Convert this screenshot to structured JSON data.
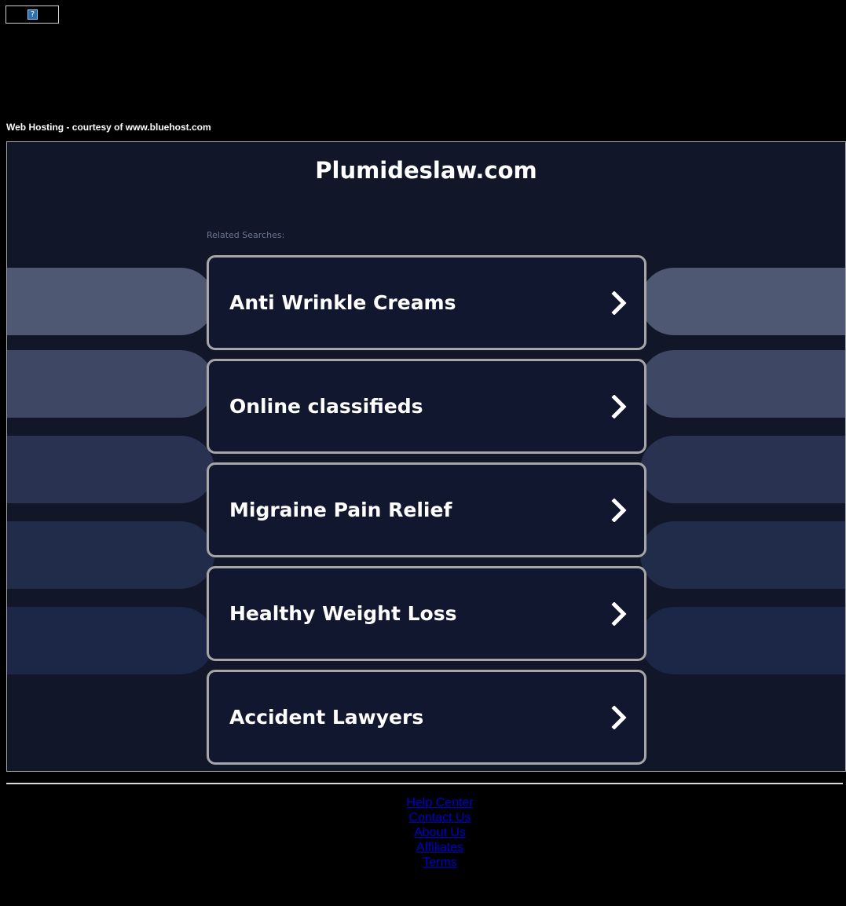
{
  "banner": {
    "icon": "broken-image-icon",
    "icon_glyph": "?"
  },
  "hosting_note": "Web Hosting - courtesy of www.bluehost.com",
  "site_title": "Plumideslaw.com",
  "related_label": "Related Searches:",
  "searches": [
    {
      "label": "Anti Wrinkle Creams"
    },
    {
      "label": "Online classifieds"
    },
    {
      "label": "Migraine Pain Relief"
    },
    {
      "label": "Healthy Weight Loss"
    },
    {
      "label": "Accident Lawyers"
    }
  ],
  "footer_links": [
    {
      "label": "Help Center"
    },
    {
      "label": "Contact Us"
    },
    {
      "label": "About Us"
    },
    {
      "label": "Affiliates"
    },
    {
      "label": "Terms"
    }
  ],
  "colors": {
    "frame_background": "#111729",
    "card_border": "#a6a6a6",
    "link_color": "#0000cc",
    "decor_pill_1": "#4f5872",
    "decor_pill_2": "#3e4764",
    "decor_pill_3": "#2a3251",
    "decor_pill_4": "#212b4a",
    "decor_pill_5": "#1c2646"
  }
}
